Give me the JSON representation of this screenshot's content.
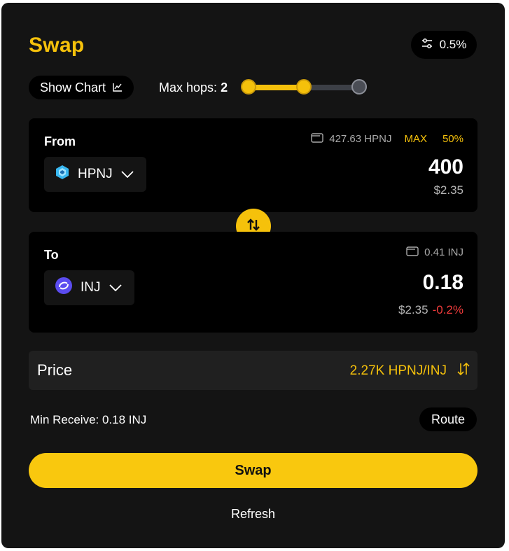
{
  "header": {
    "title": "Swap",
    "slippage": "0.5%"
  },
  "controls": {
    "show_chart_label": "Show Chart",
    "max_hops_label": "Max hops:",
    "max_hops_value": "2",
    "max_hops_level": 2,
    "max_hops_options": 3
  },
  "from": {
    "label": "From",
    "token": "HPNJ",
    "balance": "427.63 HPNJ",
    "max_label": "MAX",
    "pct_label": "50%",
    "amount": "400",
    "usd": "$2.35"
  },
  "to": {
    "label": "To",
    "token": "INJ",
    "balance": "0.41 INJ",
    "amount": "0.18",
    "usd": "$2.35",
    "change": "-0.2%"
  },
  "price": {
    "label": "Price",
    "value": "2.27K HPNJ/INJ"
  },
  "min_receive": "Min Receive: 0.18 INJ",
  "route_label": "Route",
  "swap_label": "Swap",
  "refresh_label": "Refresh",
  "colors": {
    "accent": "#f5c10b",
    "negative": "#ef3b3b",
    "panel": "#000000",
    "card": "#141414"
  }
}
